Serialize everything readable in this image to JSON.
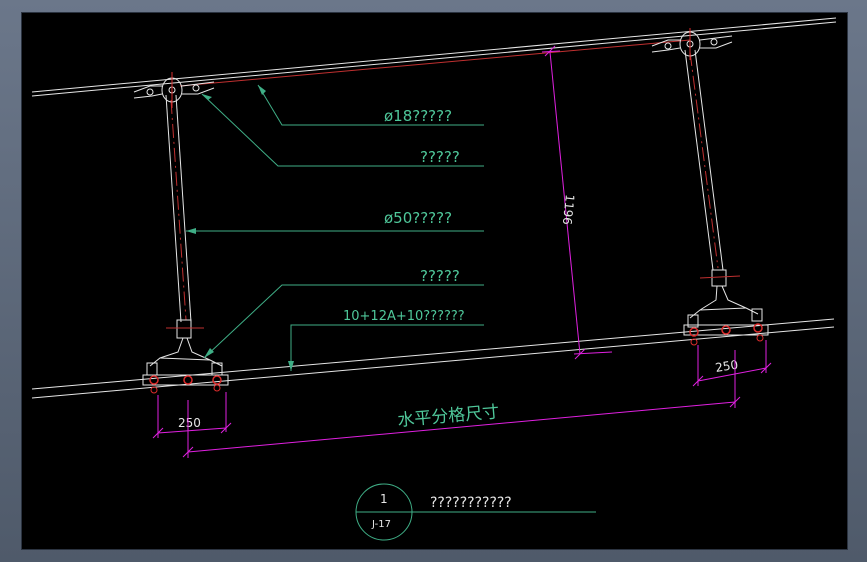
{
  "colors": {
    "background": "#000000",
    "frame": "#5f6b7c",
    "leader": "#3fae86",
    "dimension": "#e020e0",
    "line": "#e6e6e6",
    "accent": "#d92b2b"
  },
  "annotations": {
    "cable": "ø18?????",
    "clamp": "?????",
    "strut": "ø50?????",
    "base": "?????",
    "glass": "10+12A+10??????"
  },
  "dimensions": {
    "height": "1196",
    "left_offset": "250",
    "right_offset": "250",
    "horizontal_grid": "水平分格尺寸"
  },
  "detail_marker": {
    "number": "1",
    "sheet": "J-17",
    "title": "???????????"
  }
}
